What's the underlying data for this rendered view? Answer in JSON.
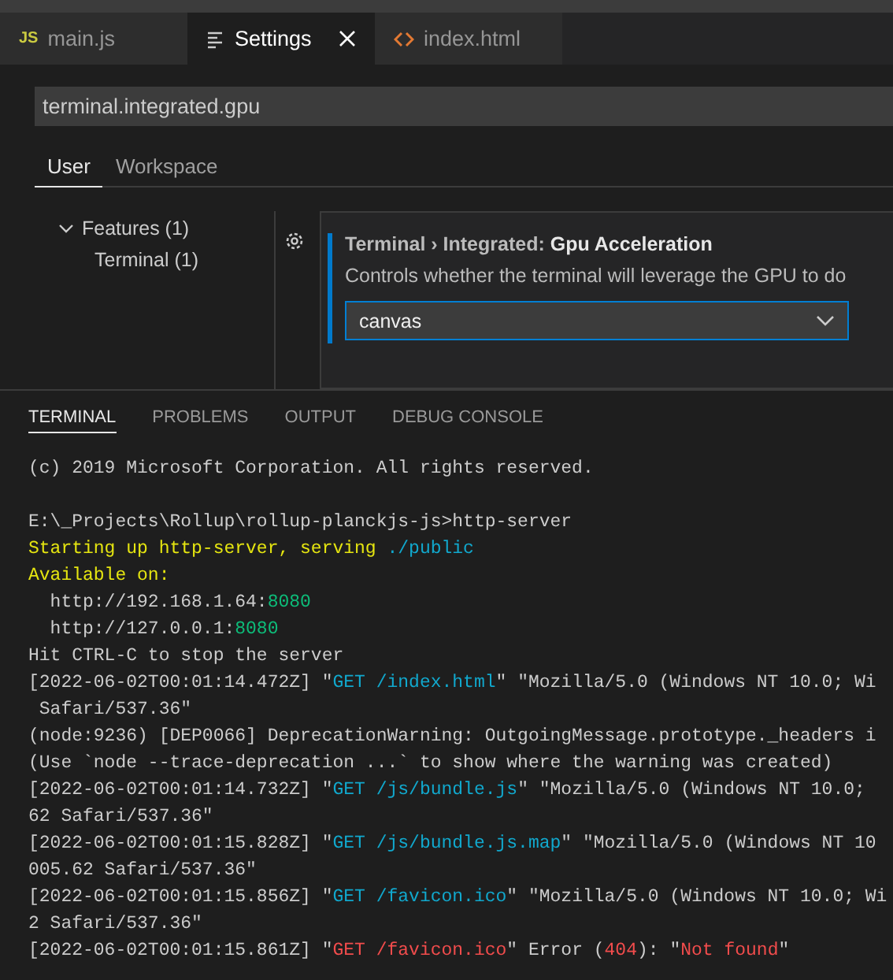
{
  "editor_tabs": [
    {
      "label": "main.js",
      "badge": "JS",
      "selected": false
    },
    {
      "label": "Settings",
      "selected": true
    },
    {
      "label": "index.html",
      "selected": false
    }
  ],
  "settings": {
    "search": {
      "value": "terminal.integrated.gpu"
    },
    "scopes": [
      {
        "label": "User",
        "selected": true
      },
      {
        "label": "Workspace",
        "selected": false
      }
    ],
    "toc": [
      {
        "label": "Features (1)",
        "expanded": true,
        "children": [
          {
            "label": "Terminal (1)"
          }
        ]
      }
    ],
    "setting": {
      "category": "Terminal › Integrated: ",
      "title": "Gpu Acceleration",
      "description": "Controls whether the terminal will leverage the GPU to do",
      "value": "canvas"
    }
  },
  "panel": {
    "tabs": [
      {
        "label": "TERMINAL",
        "selected": true
      },
      {
        "label": "PROBLEMS",
        "selected": false
      },
      {
        "label": "OUTPUT",
        "selected": false
      },
      {
        "label": "DEBUG CONSOLE",
        "selected": false
      }
    ],
    "lines": [
      [
        {
          "kind": "plain",
          "text": "(c) 2019 Microsoft Corporation. All rights reserved."
        }
      ],
      {
        "blank": true
      },
      [
        {
          "kind": "plain",
          "text": "E:\\_Projects\\Rollup\\rollup-planckjs-js>http-server"
        }
      ],
      [
        {
          "kind": "warn",
          "text": "Starting up http-server, serving "
        },
        {
          "kind": "link",
          "text": "./public"
        }
      ],
      [
        {
          "kind": "warn",
          "text": "Available on:"
        }
      ],
      [
        {
          "kind": "plain",
          "text": "  http://192.168.1.64:"
        },
        {
          "kind": "port",
          "text": "8080"
        }
      ],
      [
        {
          "kind": "plain",
          "text": "  http://127.0.0.1:"
        },
        {
          "kind": "port",
          "text": "8080"
        }
      ],
      [
        {
          "kind": "plain",
          "text": "Hit CTRL-C to stop the server"
        }
      ],
      [
        {
          "kind": "plain",
          "text": "[2022-06-02T00:01:14.472Z] \""
        },
        {
          "kind": "link",
          "text": "GET /index.html"
        },
        {
          "kind": "plain",
          "text": "\" \"Mozilla/5.0 (Windows NT 10.0; Wi"
        }
      ],
      [
        {
          "kind": "plain",
          "text": " Safari/537.36\""
        }
      ],
      [
        {
          "kind": "plain",
          "text": "(node:9236) [DEP0066] DeprecationWarning: OutgoingMessage.prototype._headers i"
        }
      ],
      [
        {
          "kind": "plain",
          "text": "(Use `node --trace-deprecation ...` to show where the warning was created)"
        }
      ],
      [
        {
          "kind": "plain",
          "text": "[2022-06-02T00:01:14.732Z] \""
        },
        {
          "kind": "link",
          "text": "GET /js/bundle.js"
        },
        {
          "kind": "plain",
          "text": "\" \"Mozilla/5.0 (Windows NT 10.0;"
        }
      ],
      [
        {
          "kind": "plain",
          "text": "62 Safari/537.36\""
        }
      ],
      [
        {
          "kind": "plain",
          "text": "[2022-06-02T00:01:15.828Z] \""
        },
        {
          "kind": "link",
          "text": "GET /js/bundle.js.map"
        },
        {
          "kind": "plain",
          "text": "\" \"Mozilla/5.0 (Windows NT 10"
        }
      ],
      [
        {
          "kind": "plain",
          "text": "005.62 Safari/537.36\""
        }
      ],
      [
        {
          "kind": "plain",
          "text": "[2022-06-02T00:01:15.856Z] \""
        },
        {
          "kind": "link",
          "text": "GET /favicon.ico"
        },
        {
          "kind": "plain",
          "text": "\" \"Mozilla/5.0 (Windows NT 10.0; Wi"
        }
      ],
      [
        {
          "kind": "plain",
          "text": "2 Safari/537.36\""
        }
      ],
      [
        {
          "kind": "plain",
          "text": "[2022-06-02T00:01:15.861Z] \""
        },
        {
          "kind": "error",
          "text": "GET /favicon.ico"
        },
        {
          "kind": "plain",
          "text": "\" Error ("
        },
        {
          "kind": "error",
          "text": "404"
        },
        {
          "kind": "plain",
          "text": "): \""
        },
        {
          "kind": "error",
          "text": "Not found"
        },
        {
          "kind": "plain",
          "text": "\""
        }
      ]
    ]
  }
}
